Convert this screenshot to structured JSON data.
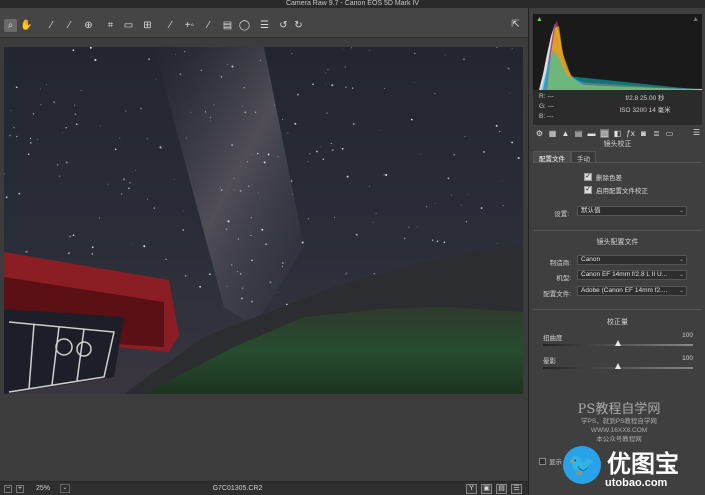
{
  "window": {
    "title": "Camera Raw 9.7  -  Canon EOS 5D Mark IV"
  },
  "toolbar": {
    "tools": [
      {
        "name": "zoom-tool",
        "icon": "zoom-icon",
        "glyph": "⌕",
        "active": true
      },
      {
        "name": "hand-tool",
        "icon": "hand-icon",
        "glyph": "✋",
        "active": false
      },
      {
        "name": "white-balance-tool",
        "icon": "eyedropper-icon",
        "glyph": "⁄",
        "active": false
      },
      {
        "name": "color-sampler-tool",
        "icon": "color-sampler-icon",
        "glyph": "⁄",
        "active": false
      },
      {
        "name": "targeted-adjustment-tool",
        "icon": "target-adjust-icon",
        "glyph": "⊕",
        "active": false
      },
      {
        "name": "crop-tool",
        "icon": "crop-icon",
        "glyph": "⌗",
        "active": false
      },
      {
        "name": "straighten-tool",
        "icon": "straighten-icon",
        "glyph": "▭",
        "active": false
      },
      {
        "name": "transform-tool",
        "icon": "transform-icon",
        "glyph": "⊞",
        "active": false
      },
      {
        "name": "spot-removal-tool",
        "icon": "spot-removal-icon",
        "glyph": "⁄",
        "active": false
      },
      {
        "name": "red-eye-tool",
        "icon": "red-eye-icon",
        "glyph": "+◦",
        "active": false
      },
      {
        "name": "adjustment-brush-tool",
        "icon": "brush-icon",
        "glyph": "⁄",
        "active": false
      },
      {
        "name": "graduated-filter-tool",
        "icon": "graduated-filter-icon",
        "glyph": "▤",
        "active": false
      },
      {
        "name": "radial-filter-tool",
        "icon": "radial-filter-icon",
        "glyph": "◯",
        "active": false
      },
      {
        "name": "preferences-button",
        "icon": "list-icon",
        "glyph": "☰",
        "active": false
      },
      {
        "name": "rotate-left-button",
        "icon": "rotate-left-icon",
        "glyph": "↺",
        "active": false
      },
      {
        "name": "rotate-right-button",
        "icon": "rotate-right-icon",
        "glyph": "↻",
        "active": false
      }
    ],
    "fullscreen_glyph": "⇱"
  },
  "status": {
    "zoom_out": "−",
    "zoom_in": "+",
    "zoom": "25%",
    "zoom_caret": "⌄",
    "filename": "G7C01305.CR2",
    "view_buttons": [
      "Y",
      "▣",
      "▤",
      "☰"
    ]
  },
  "histogram": {
    "warn_shadow": "▲",
    "warn_highlight": "▲"
  },
  "readout": {
    "r_label": "R:",
    "r_value": "---",
    "g_label": "G:",
    "g_value": "---",
    "b_label": "B:",
    "b_value": "---",
    "aperture_shutter": "f/2.8   25.00 秒",
    "iso_focal": "ISO 3200   14 毫米"
  },
  "panel_tabs": [
    "⚙",
    "▦",
    "▲",
    "▤",
    "▬",
    "▥",
    "◧",
    "ƒx",
    "◙",
    "≣",
    "▭"
  ],
  "panel_tabs_menu": "☰",
  "lens": {
    "section_title": "镜头校正",
    "subtabs": [
      "配置文件",
      "手动"
    ],
    "remove_ca": "删除色差",
    "enable_profile": "启用配置文件校正",
    "check_mark": "✓",
    "setup_label": "设置:",
    "setup_value": "默认值",
    "profile_title": "镜头配置文件",
    "make_label": "制造商:",
    "make_value": "Canon",
    "model_label": "机型:",
    "model_value": "Canon EF 14mm f/2.8 L II U...",
    "profile_label": "配置文件:",
    "profile_value": "Adobe (Canon EF 14mm f2....",
    "amount_title": "校正量",
    "distortion_label": "扭曲度",
    "distortion_value": "100",
    "distortion": 100,
    "vignetting_label": "晕影",
    "vignetting_value": "100",
    "vignetting": 100,
    "caret": "⌄"
  },
  "watermark": {
    "line1": "PS教程自学网",
    "line2": "学PS，就到PS教程自学网",
    "line3": "WWW.16XX8.COM",
    "line4": "本公众号教程网"
  },
  "logo": {
    "brand": "优图宝",
    "domain": "utobao.com",
    "bird": "🐦"
  },
  "panel_check_label": "显示"
}
